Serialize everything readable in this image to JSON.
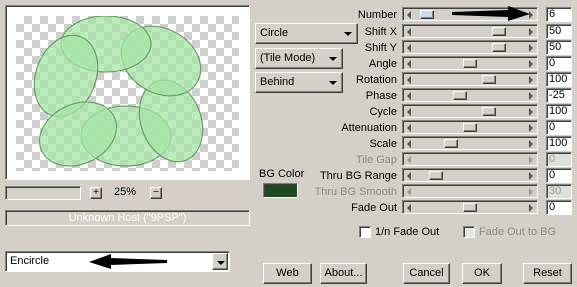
{
  "preview": {
    "zoom": "25%",
    "host_text": "Unknown Host (\"9PSP\")"
  },
  "effect_select": {
    "value": "Encircle"
  },
  "shape_select": {
    "value": "Circle"
  },
  "tile_select": {
    "value": "(Tile Mode)"
  },
  "blend_select": {
    "value": "Behind"
  },
  "bg_color": {
    "label": "BG Color",
    "color": "#1f4a1f"
  },
  "params": [
    {
      "label": "Number",
      "value": "6",
      "thumb_pct": 0.05,
      "disabled": false
    },
    {
      "label": "Shift X",
      "value": "50",
      "thumb_pct": 0.8,
      "disabled": false
    },
    {
      "label": "Shift Y",
      "value": "50",
      "thumb_pct": 0.8,
      "disabled": false
    },
    {
      "label": "Angle",
      "value": "0",
      "thumb_pct": 0.5,
      "disabled": false
    },
    {
      "label": "Rotation",
      "value": "100",
      "thumb_pct": 0.7,
      "disabled": false
    },
    {
      "label": "Phase",
      "value": "-25",
      "thumb_pct": 0.4,
      "disabled": false
    },
    {
      "label": "Cycle",
      "value": "100",
      "thumb_pct": 0.7,
      "disabled": false
    },
    {
      "label": "Attenuation",
      "value": "0",
      "thumb_pct": 0.5,
      "disabled": false
    },
    {
      "label": "Scale",
      "value": "100",
      "thumb_pct": 0.3,
      "disabled": false
    },
    {
      "label": "Tile Gap",
      "value": "0",
      "thumb_pct": 0.0,
      "disabled": true
    },
    {
      "label": "Thru BG Range",
      "value": "0",
      "thumb_pct": 0.15,
      "disabled": false
    },
    {
      "label": "Thru BG Smooth",
      "value": "30",
      "thumb_pct": 0.0,
      "disabled": true
    },
    {
      "label": "Fade Out",
      "value": "0",
      "thumb_pct": 0.5,
      "disabled": false
    }
  ],
  "checkboxes": {
    "fade_out_1n": {
      "label": "1/n Fade Out",
      "checked": false,
      "disabled": false
    },
    "fade_out_bg": {
      "label": "Fade Out to BG",
      "checked": false,
      "disabled": true
    }
  },
  "buttons": {
    "web": "Web",
    "about": "About...",
    "cancel": "Cancel",
    "ok": "OK",
    "reset": "Reset"
  },
  "colors": {
    "dialog_bg": "#d4d0c8",
    "preview_fill": "#a8e6a8",
    "preview_stroke": "#6fa86f"
  }
}
